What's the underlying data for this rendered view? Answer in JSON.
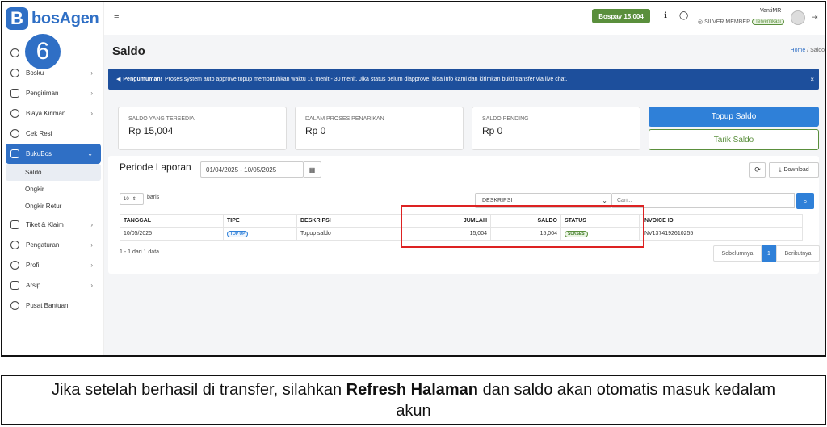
{
  "step": "6",
  "brand": {
    "logo_letter": "B",
    "name": "bosAgen"
  },
  "sidebar": {
    "items": [
      {
        "label": "Bosku"
      },
      {
        "label": "Pengiriman"
      },
      {
        "label": "Biaya Kiriman"
      },
      {
        "label": "Cek Resi"
      },
      {
        "label": "BukuBos"
      },
      {
        "label": "Tiket & Klaim"
      },
      {
        "label": "Pengaturan"
      },
      {
        "label": "Profil"
      },
      {
        "label": "Arsip"
      },
      {
        "label": "Pusat Bantuan"
      }
    ],
    "sub_items": [
      {
        "label": "Saldo"
      },
      {
        "label": "Ongkir"
      },
      {
        "label": "Ongkir Retur"
      }
    ]
  },
  "topbar": {
    "bospay_label": "Bospay 15,004",
    "user_name": "VantiMR",
    "member_label": "SILVER MEMBER",
    "verified_label": "Terverifikasi"
  },
  "page": {
    "title": "Saldo",
    "breadcrumb_home": "Home",
    "breadcrumb_sep": "/",
    "breadcrumb_current": "Saldo"
  },
  "announcement": {
    "label": "Pengumuman!",
    "text": "Proses system auto approve topup membutuhkan waktu 10 menit - 30 menit. Jika status belum diapprove, bisa info kami dan kirimkan bukti transfer via live chat.",
    "close": "×"
  },
  "cards": [
    {
      "label": "SALDO YANG TERSEDIA",
      "value": "Rp 15,004"
    },
    {
      "label": "DALAM PROSES PENARIKAN",
      "value": "Rp 0"
    },
    {
      "label": "SALDO PENDING",
      "value": "Rp 0"
    }
  ],
  "actions": {
    "topup": "Topup Saldo",
    "tarik": "Tarik Saldo"
  },
  "report": {
    "period_label": "Periode Laporan",
    "date_range": "01/04/2025 - 10/05/2025",
    "download_label": "Download",
    "rows_value": "10",
    "rows_label": "baris",
    "filter_value": "DESKRIPSI",
    "search_placeholder": "Cari..."
  },
  "table": {
    "headers": [
      "TANGGAL",
      "TIPE",
      "DESKRIPSI",
      "JUMLAH",
      "SALDO",
      "STATUS",
      "INVOICE ID"
    ],
    "rows": [
      {
        "tanggal": "10/05/2025",
        "tipe": "TOP UP",
        "deskripsi": "Topup saldo",
        "jumlah": "15,004",
        "saldo": "15,004",
        "status": "SUKSES",
        "invoice": "INV1374192610255"
      }
    ]
  },
  "pagination": {
    "summary": "1 - 1 dari 1 data",
    "prev": "Sebelumnya",
    "current": "1",
    "next": "Berikutnya"
  },
  "caption": {
    "before": "Jika setelah berhasil di transfer, silahkan ",
    "bold": "Refresh Halaman",
    "after": " dan saldo akan otomatis masuk kedalam akun"
  },
  "colors": {
    "brand": "#2f6fc5",
    "announcement": "#1d4f9c",
    "primary_button": "#2f80d8",
    "success": "#5a8f3c",
    "highlight": "#dd2222"
  }
}
